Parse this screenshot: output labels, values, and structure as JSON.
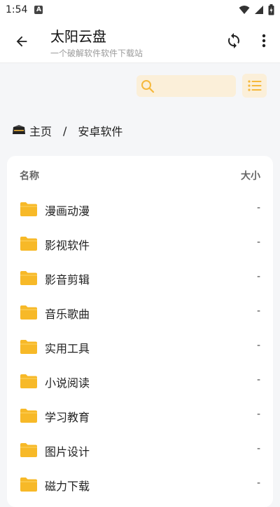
{
  "status": {
    "time": "1:54",
    "badge": "A"
  },
  "app_bar": {
    "title": "太阳云盘",
    "subtitle": "一个破解软件软件下载站"
  },
  "search": {
    "value": "",
    "placeholder": ""
  },
  "breadcrumb": {
    "home": "主页",
    "separator": "/",
    "current": "安卓软件"
  },
  "list": {
    "header_name": "名称",
    "header_size": "大小",
    "rows": [
      {
        "name": "漫画动漫",
        "size": "-"
      },
      {
        "name": "影视软件",
        "size": "-"
      },
      {
        "name": "影音剪辑",
        "size": "-"
      },
      {
        "name": "音乐歌曲",
        "size": "-"
      },
      {
        "name": "实用工具",
        "size": "-"
      },
      {
        "name": "小说阅读",
        "size": "-"
      },
      {
        "name": "学习教育",
        "size": "-"
      },
      {
        "name": "图片设计",
        "size": "-"
      },
      {
        "name": "磁力下载",
        "size": "-"
      }
    ]
  },
  "colors": {
    "accent": "#f5b83c",
    "accent_light": "#fbefd9",
    "folder": "#f7b928"
  },
  "icons": {
    "back": "arrow-left-icon",
    "sync": "sync-icon",
    "more": "more-vertical-icon",
    "search": "search-icon",
    "list": "list-view-icon",
    "home": "drive-logo-icon",
    "folder": "folder-icon"
  }
}
